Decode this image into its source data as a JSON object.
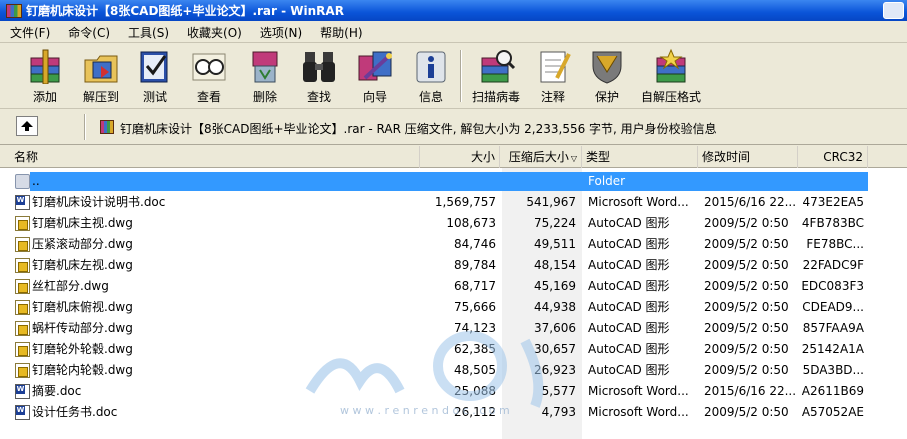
{
  "window": {
    "title": "钉磨机床设计【8张CAD图纸+毕业论文】.rar - WinRAR"
  },
  "menu": [
    "文件(F)",
    "命令(C)",
    "工具(S)",
    "收藏夹(O)",
    "选项(N)",
    "帮助(H)"
  ],
  "toolbar": [
    {
      "label": "添加",
      "icon": "add-books-icon"
    },
    {
      "label": "解压到",
      "icon": "extract-folder-icon"
    },
    {
      "label": "测试",
      "icon": "test-checkbook-icon"
    },
    {
      "label": "查看",
      "icon": "view-glasses-icon"
    },
    {
      "label": "删除",
      "icon": "delete-recycle-icon"
    },
    {
      "label": "查找",
      "icon": "find-binoculars-icon"
    },
    {
      "label": "向导",
      "icon": "wizard-icon"
    },
    {
      "label": "信息",
      "icon": "info-icon"
    },
    {
      "label": "扫描病毒",
      "icon": "virus-scan-icon"
    },
    {
      "label": "注释",
      "icon": "comment-notepad-icon"
    },
    {
      "label": "保护",
      "icon": "protect-shield-icon"
    },
    {
      "label": "自解压格式",
      "icon": "sfx-icon"
    }
  ],
  "address": {
    "text": "钉磨机床设计【8张CAD图纸+毕业论文】.rar - RAR 压缩文件, 解包大小为 2,233,556 字节, 用户身份校验信息"
  },
  "columns": {
    "name": "名称",
    "size": "大小",
    "packed": "压缩后大小",
    "type": "类型",
    "modified": "修改时间",
    "crc": "CRC32"
  },
  "files": [
    {
      "name": "..",
      "size": "",
      "packed": "",
      "type": "Folder",
      "modified": "",
      "crc": "",
      "icon": "folder"
    },
    {
      "name": "钉磨机床设计说明书.doc",
      "size": "1,569,757",
      "packed": "541,967",
      "type": "Microsoft Word...",
      "modified": "2015/6/16 22...",
      "crc": "473E2EA5",
      "icon": "doc"
    },
    {
      "name": "钉磨机床主视.dwg",
      "size": "108,673",
      "packed": "75,224",
      "type": "AutoCAD 图形",
      "modified": "2009/5/2 0:50",
      "crc": "4FB783BC",
      "icon": "dwg"
    },
    {
      "name": "压紧滚动部分.dwg",
      "size": "84,746",
      "packed": "49,511",
      "type": "AutoCAD 图形",
      "modified": "2009/5/2 0:50",
      "crc": "FE78BC...",
      "icon": "dwg"
    },
    {
      "name": "钉磨机床左视.dwg",
      "size": "89,784",
      "packed": "48,154",
      "type": "AutoCAD 图形",
      "modified": "2009/5/2 0:50",
      "crc": "22FADC9F",
      "icon": "dwg"
    },
    {
      "name": "丝杠部分.dwg",
      "size": "68,717",
      "packed": "45,169",
      "type": "AutoCAD 图形",
      "modified": "2009/5/2 0:50",
      "crc": "EDC083F3",
      "icon": "dwg"
    },
    {
      "name": "钉磨机床俯视.dwg",
      "size": "75,666",
      "packed": "44,938",
      "type": "AutoCAD 图形",
      "modified": "2009/5/2 0:50",
      "crc": "CDEAD9...",
      "icon": "dwg"
    },
    {
      "name": "蜗杆传动部分.dwg",
      "size": "74,123",
      "packed": "37,606",
      "type": "AutoCAD 图形",
      "modified": "2009/5/2 0:50",
      "crc": "857FAA9A",
      "icon": "dwg"
    },
    {
      "name": "钉磨轮外轮毂.dwg",
      "size": "62,385",
      "packed": "30,657",
      "type": "AutoCAD 图形",
      "modified": "2009/5/2 0:50",
      "crc": "25142A1A",
      "icon": "dwg"
    },
    {
      "name": "钉磨轮内轮毂.dwg",
      "size": "48,505",
      "packed": "26,923",
      "type": "AutoCAD 图形",
      "modified": "2009/5/2 0:50",
      "crc": "5DA3BD...",
      "icon": "dwg"
    },
    {
      "name": "摘要.doc",
      "size": "25,088",
      "packed": "5,577",
      "type": "Microsoft Word...",
      "modified": "2015/6/16 22...",
      "crc": "A2611B69",
      "icon": "doc"
    },
    {
      "name": "设计任务书.doc",
      "size": "26,112",
      "packed": "4,793",
      "type": "Microsoft Word...",
      "modified": "2009/5/2 0:50",
      "crc": "A57052AE",
      "icon": "doc"
    }
  ],
  "watermark": {
    "text": "w w w . r e n r e n d o c . c o m"
  }
}
